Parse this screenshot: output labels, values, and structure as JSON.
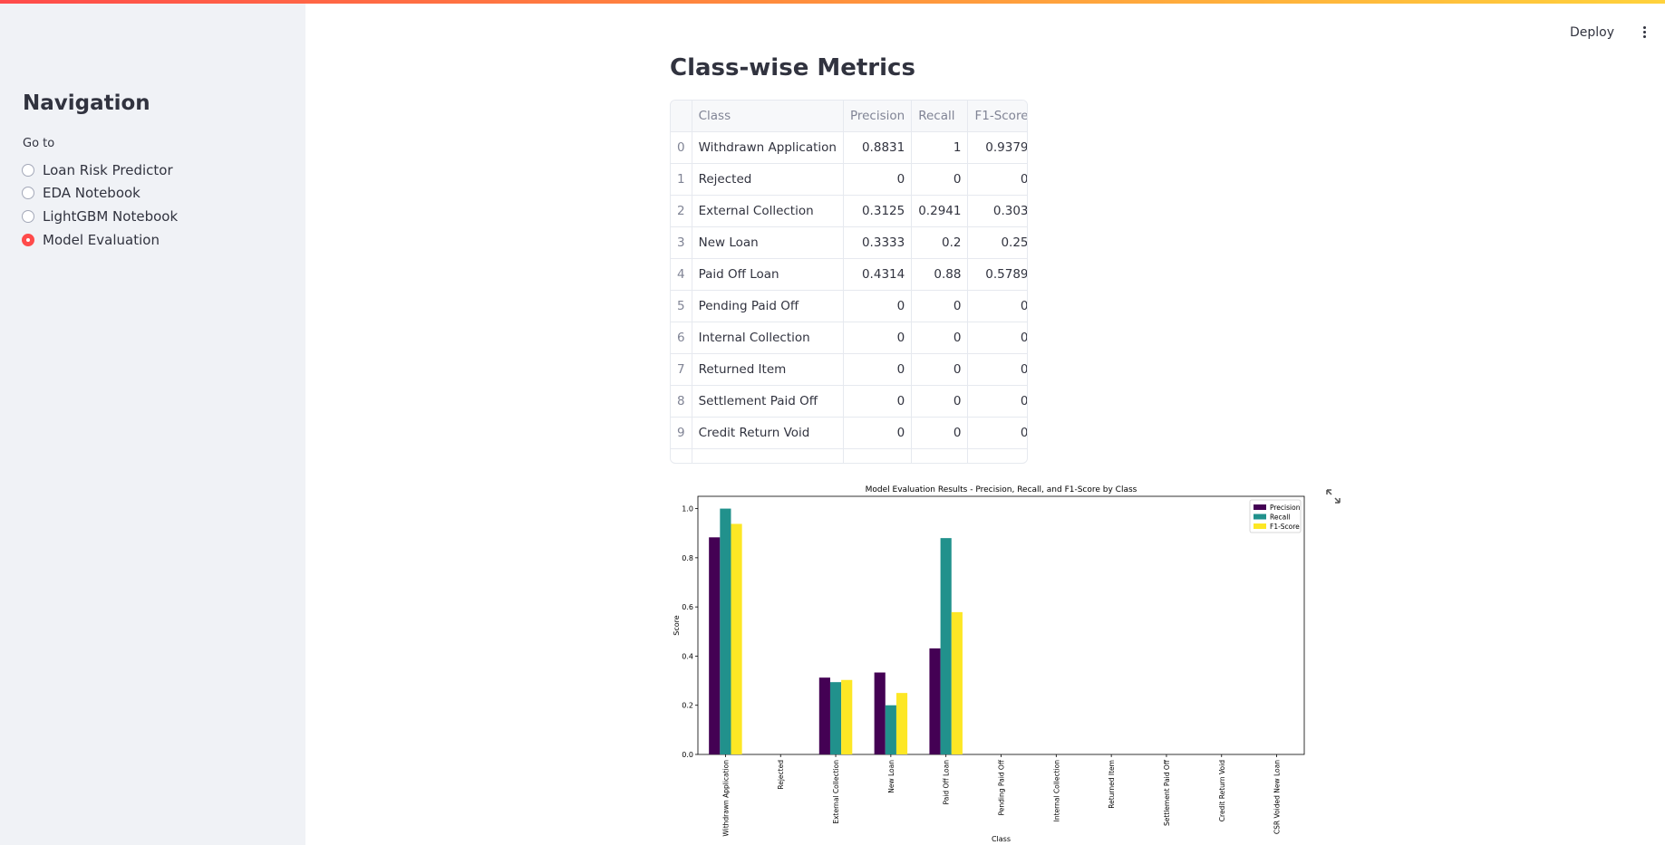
{
  "sidebar": {
    "title": "Navigation",
    "goto_label": "Go to",
    "options": [
      {
        "label": "Loan Risk Predictor",
        "selected": false
      },
      {
        "label": "EDA Notebook",
        "selected": false
      },
      {
        "label": "LightGBM Notebook",
        "selected": false
      },
      {
        "label": "Model Evaluation",
        "selected": true
      }
    ]
  },
  "header": {
    "deploy_label": "Deploy",
    "menu_icon": "kebab-menu-icon"
  },
  "main": {
    "title": "Class-wise Metrics",
    "table": {
      "columns": [
        "",
        "Class",
        "Precision",
        "Recall",
        "F1-Score"
      ],
      "rows": [
        [
          "0",
          "Withdrawn Application",
          "0.8831",
          "1",
          "0.9379"
        ],
        [
          "1",
          "Rejected",
          "0",
          "0",
          "0"
        ],
        [
          "2",
          "External Collection",
          "0.3125",
          "0.2941",
          "0.303"
        ],
        [
          "3",
          "New Loan",
          "0.3333",
          "0.2",
          "0.25"
        ],
        [
          "4",
          "Paid Off Loan",
          "0.4314",
          "0.88",
          "0.5789"
        ],
        [
          "5",
          "Pending Paid Off",
          "0",
          "0",
          "0"
        ],
        [
          "6",
          "Internal Collection",
          "0",
          "0",
          "0"
        ],
        [
          "7",
          "Returned Item",
          "0",
          "0",
          "0"
        ],
        [
          "8",
          "Settlement Paid Off",
          "0",
          "0",
          "0"
        ],
        [
          "9",
          "Credit Return Void",
          "0",
          "0",
          "0"
        ]
      ]
    }
  },
  "colors": {
    "accent": "#ff4b4b",
    "sidebar_bg": "#f0f2f6",
    "precision": "#440154",
    "recall": "#21918c",
    "f1": "#fde725"
  },
  "chart_data": {
    "type": "bar",
    "title": "Model Evaluation Results - Precision, Recall, and F1-Score by Class",
    "xlabel": "Class",
    "ylabel": "Score",
    "ylim": [
      0,
      1.05
    ],
    "yticks": [
      "0.0",
      "0.2",
      "0.4",
      "0.6",
      "0.8",
      "1.0"
    ],
    "legend_position": "top-right",
    "categories": [
      "Withdrawn Application",
      "Rejected",
      "External Collection",
      "New Loan",
      "Paid Off Loan",
      "Pending Paid Off",
      "Internal Collection",
      "Returned Item",
      "Settlement Paid Off",
      "Credit Return Void",
      "CSR Voided New Loan"
    ],
    "series": [
      {
        "name": "Precision",
        "color": "#440154",
        "values": [
          0.8831,
          0,
          0.3125,
          0.3333,
          0.4314,
          0,
          0,
          0,
          0,
          0,
          0
        ]
      },
      {
        "name": "Recall",
        "color": "#21918c",
        "values": [
          1,
          0,
          0.2941,
          0.2,
          0.88,
          0,
          0,
          0,
          0,
          0,
          0
        ]
      },
      {
        "name": "F1-Score",
        "color": "#fde725",
        "values": [
          0.9379,
          0,
          0.303,
          0.25,
          0.5789,
          0,
          0,
          0,
          0,
          0,
          0
        ]
      }
    ]
  }
}
